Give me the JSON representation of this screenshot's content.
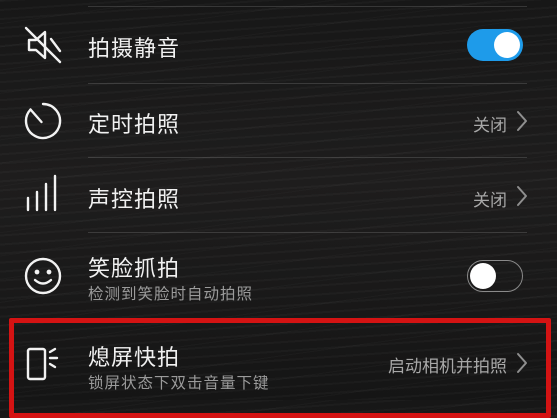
{
  "settings": {
    "mute": {
      "label": "拍摄静音",
      "icon": "speaker-mute-icon",
      "toggle": "on"
    },
    "timer": {
      "label": "定时拍照",
      "icon": "timer-icon",
      "value": "关闭"
    },
    "voice": {
      "label": "声控拍照",
      "icon": "sound-bars-icon",
      "value": "关闭"
    },
    "smile": {
      "label": "笑脸抓拍",
      "sublabel": "检测到笑脸时自动拍照",
      "icon": "smiley-face-icon",
      "toggle": "off"
    },
    "quick_snap": {
      "label": "熄屏快拍",
      "sublabel": "锁屏状态下双击音量下键",
      "icon": "phone-flash-icon",
      "value": "启动相机并拍照"
    }
  },
  "colors": {
    "toggle_on": "#1e9bea",
    "highlight_border": "#d41313"
  }
}
